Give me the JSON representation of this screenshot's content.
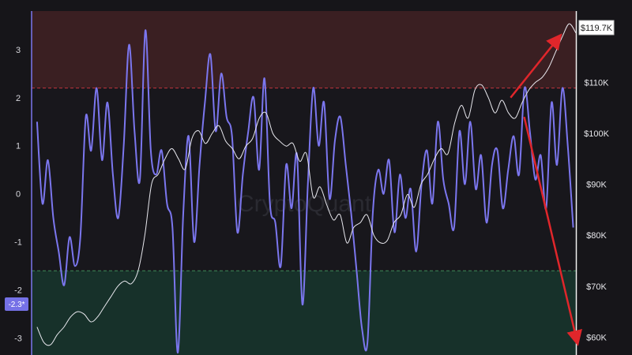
{
  "chart_data": {
    "type": "line",
    "title": "",
    "xlabel": "",
    "ylabel": "",
    "watermark": "CryptoQuant",
    "left_axis": {
      "ylim": [
        -3.35,
        3.8
      ],
      "ticks": [
        -3,
        -2,
        -1,
        0,
        1,
        2,
        3
      ]
    },
    "right_axis": {
      "ylim": [
        56500,
        124000
      ],
      "ticks": [
        {
          "value": 60000,
          "label": "$60K"
        },
        {
          "value": 70000,
          "label": "$70K"
        },
        {
          "value": 80000,
          "label": "$80K"
        },
        {
          "value": 90000,
          "label": "$90K"
        },
        {
          "value": 100000,
          "label": "$100K"
        },
        {
          "value": 110000,
          "label": "$110K"
        }
      ]
    },
    "bands": [
      {
        "name": "overheated",
        "from": 2.2,
        "to": 3.8,
        "color": "#3a1f22",
        "line_color": "#c0353b"
      },
      {
        "name": "undervalued",
        "from": -3.35,
        "to": -1.6,
        "color": "#17312a",
        "line_color": "#3f8a58"
      }
    ],
    "series": [
      {
        "axis": "left",
        "color": "#7b76ee",
        "values": [
          1.5,
          -0.2,
          0.7,
          -0.5,
          -1.2,
          -1.9,
          -0.9,
          -1.5,
          -0.9,
          1.6,
          0.9,
          2.2,
          0.7,
          1.9,
          0.4,
          -0.5,
          1.0,
          3.1,
          1.3,
          0.3,
          3.4,
          0.9,
          0.4,
          0.9,
          -0.2,
          -0.7,
          -3.3,
          -0.4,
          1.2,
          -1.0,
          0.6,
          1.9,
          2.9,
          1.3,
          2.5,
          1.6,
          1.2,
          -0.8,
          0.4,
          1.3,
          2.0,
          0.5,
          2.4,
          -0.2,
          -0.6,
          -1.5,
          0.6,
          -0.3,
          0.8,
          -2.3,
          0.2,
          2.2,
          1.0,
          1.9,
          -0.1,
          1.1,
          1.6,
          0.6,
          -0.4,
          -1.6,
          -2.8,
          -3.1,
          -0.4,
          0.5,
          0.0,
          0.7,
          -0.8,
          0.4,
          -0.5,
          0.1,
          -1.2,
          0.2,
          0.9,
          -0.2,
          1.5,
          0.3,
          -0.2,
          -0.7,
          1.3,
          0.2,
          1.5,
          0.1,
          0.8,
          -0.6,
          0.6,
          0.9,
          -0.3,
          0.5,
          1.2,
          0.4,
          2.2,
          1.3,
          0.3,
          0.8,
          -0.3,
          1.9,
          0.6,
          2.2,
          1.0,
          -0.7
        ]
      },
      {
        "axis": "right",
        "color": "#e8e8ee",
        "values": [
          62000,
          59000,
          58500,
          60500,
          62000,
          64000,
          65000,
          64500,
          63000,
          64000,
          66000,
          68000,
          70000,
          71000,
          70500,
          73000,
          80000,
          90000,
          92000,
          95000,
          97000,
          95000,
          93000,
          99000,
          100500,
          98000,
          100000,
          101500,
          98500,
          97000,
          95000,
          97500,
          99000,
          103000,
          104000,
          100000,
          98500,
          97500,
          98000,
          94500,
          96000,
          87500,
          89500,
          86000,
          83000,
          84000,
          78500,
          81500,
          82500,
          84000,
          80000,
          78500,
          79000,
          82500,
          84000,
          88000,
          85500,
          90000,
          92000,
          95000,
          97000,
          96000,
          102000,
          105500,
          103000,
          108500,
          109500,
          107000,
          104000,
          106500,
          104000,
          103000,
          106000,
          108500,
          110000,
          111000,
          113000,
          116000,
          119000,
          121500,
          119700
        ]
      }
    ],
    "current_labels": {
      "left": "-2.3*",
      "right": "$119.7K"
    },
    "arrows": [
      {
        "color": "#e0262b",
        "from": [
          0.88,
          2.0
        ],
        "to": [
          0.97,
          119000
        ],
        "direction": "up"
      },
      {
        "color": "#e0262b",
        "from": [
          0.905,
          1.6
        ],
        "to": [
          0.985,
          59000
        ],
        "direction": "down"
      }
    ]
  }
}
